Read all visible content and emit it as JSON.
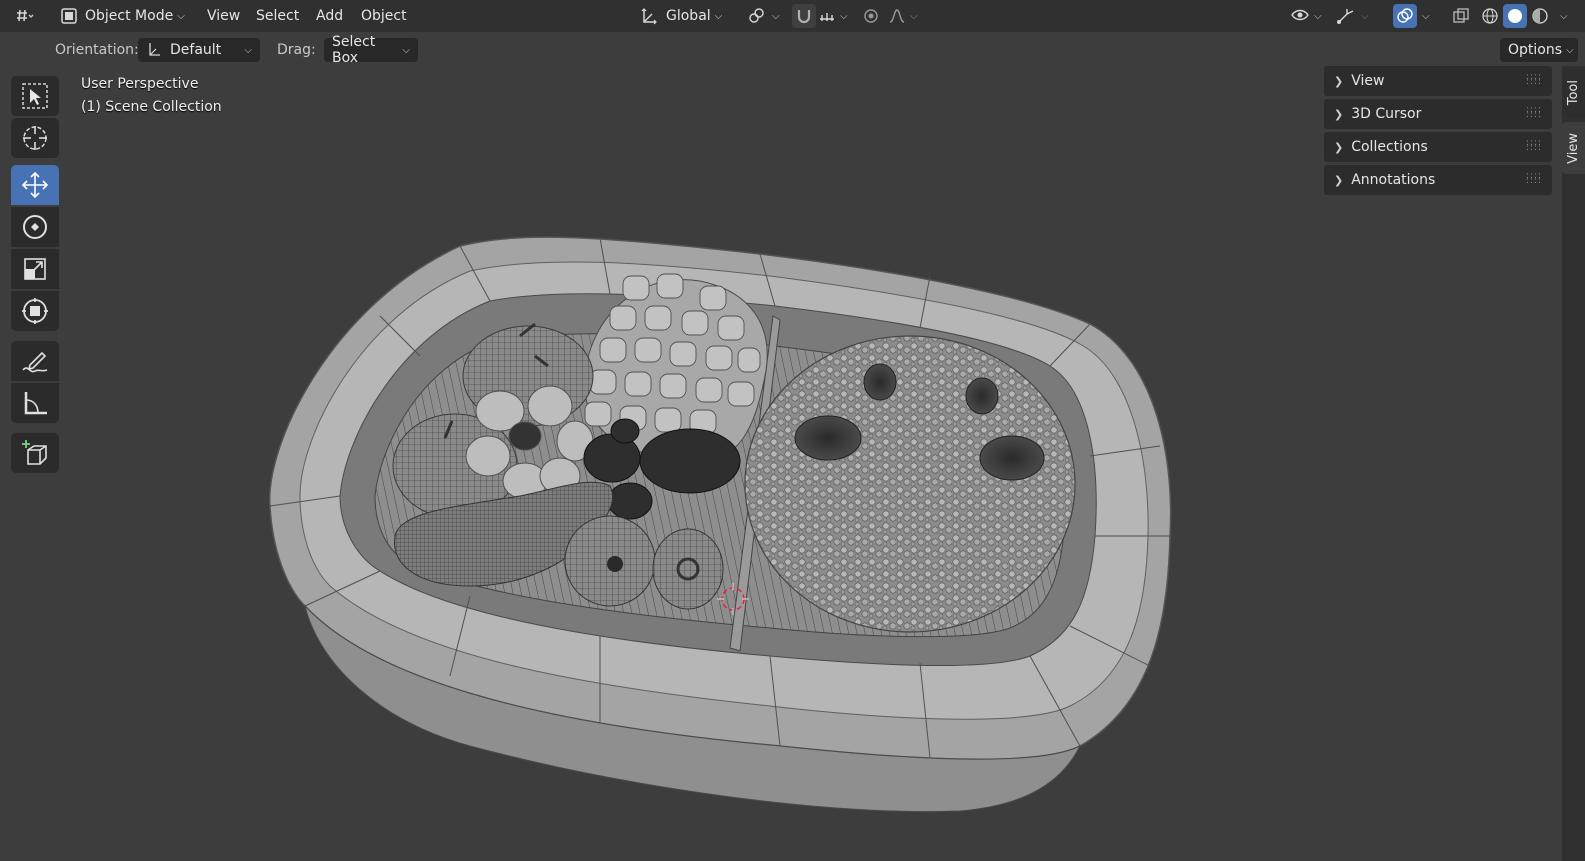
{
  "header": {
    "editor_type_icon": "editor-type-3d-viewport-icon",
    "mode": {
      "icon": "object-mode-icon",
      "label": "Object Mode"
    },
    "menus": [
      "View",
      "Select",
      "Add",
      "Object"
    ],
    "orientation": {
      "icon": "transform-orientation-icon",
      "label": "Global"
    },
    "right_icons": [
      "visibility-icon",
      "gizmo-icon",
      "overlay-icon",
      "xray-icon",
      "wireframe-shading-icon",
      "solid-shading-icon",
      "material-shading-icon"
    ]
  },
  "tool_settings": {
    "orientation_label": "Orientation:",
    "orientation_value": "Default",
    "drag_label": "Drag:",
    "drag_value": "Select Box",
    "options_label": "Options"
  },
  "toolbar": {
    "tools": [
      {
        "name": "select-box-icon",
        "active": false
      },
      {
        "name": "cursor-icon",
        "active": false
      },
      {
        "name": "move-icon",
        "active": true
      },
      {
        "name": "rotate-icon",
        "active": false
      },
      {
        "name": "scale-icon",
        "active": false
      },
      {
        "name": "transform-icon",
        "active": false
      },
      {
        "name": "annotate-icon",
        "active": false
      },
      {
        "name": "measure-icon",
        "active": false
      },
      {
        "name": "add-cube-icon",
        "active": false
      }
    ]
  },
  "viewport": {
    "perspective": "User Perspective",
    "collection": "(1) Scene Collection",
    "model_description": "Wireframe-overlay 3D model of a rounded rectangular tray holding vegetables (corn, tomatoes, broccoli, onion, mushroom pile)"
  },
  "npanel": {
    "sections": [
      "View",
      "3D Cursor",
      "Collections",
      "Annotations"
    ],
    "tabs": [
      "Tool",
      "View"
    ]
  },
  "colors": {
    "header_bg": "#303030",
    "viewport_bg": "#3d3d3d",
    "accent_active": "#4772b3",
    "panel_bg": "#2c2c2c"
  }
}
